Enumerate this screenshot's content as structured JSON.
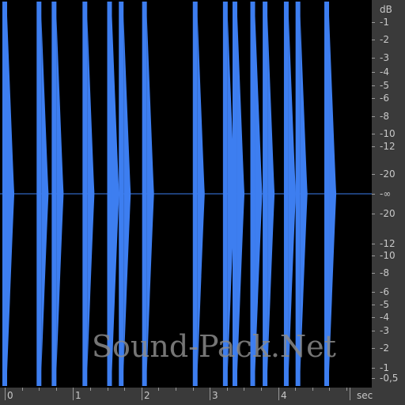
{
  "waveform": {
    "color": "#3d7ef0",
    "background": "#000000",
    "transients_sec": [
      0.0,
      0.5,
      0.72,
      1.17,
      1.53,
      1.7,
      2.04,
      2.78,
      3.22,
      3.36,
      3.62,
      3.8,
      4.11,
      4.28,
      4.7
    ]
  },
  "db_ruler": {
    "unit": "dB",
    "upper_labels": [
      "-1",
      "-2",
      "-3",
      "-4",
      "-5",
      "-6",
      "-8",
      "-10",
      "-12",
      "-20"
    ],
    "center_label": "-∞",
    "lower_labels": [
      "-20",
      "-12",
      "-10",
      "-8",
      "-6",
      "-5",
      "-4",
      "-3",
      "-2",
      "-1",
      "-0,5"
    ]
  },
  "time_ruler": {
    "unit": "sec",
    "labels": [
      "0",
      "1",
      "2",
      "3",
      "4"
    ]
  },
  "watermark": "Sound-Pack.Net"
}
